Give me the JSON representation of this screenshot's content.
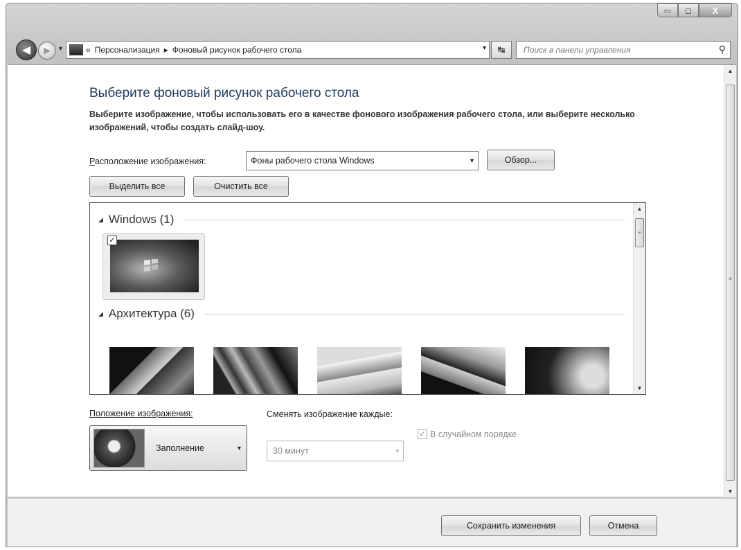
{
  "titlebar": {
    "minimize": "▭",
    "maximize": "◻",
    "close": "X"
  },
  "nav": {
    "back": "◀",
    "forward": "▶",
    "history": "▼",
    "breadcrumb_prefix": "«",
    "breadcrumb": [
      "Персонализация",
      "Фоновый рисунок рабочего стола"
    ],
    "sep": "▸",
    "address_dropdown": "▾",
    "refresh": "↹",
    "search_placeholder": "Поиск в панели управления",
    "search_icon": "⚲"
  },
  "main": {
    "title": "Выберите фоновый рисунок рабочего стола",
    "description": "Выберите изображение, чтобы использовать его в качестве фонового изображения рабочего стола, или выберите несколько изображений, чтобы создать слайд-шоу.",
    "location_label_accel": "Р",
    "location_label_rest": "асположение изображения:",
    "location_value": "Фоны рабочего стола Windows",
    "browse_button": "Обзор...",
    "select_all_button": "Выделить все",
    "clear_all_button": "Очистить все"
  },
  "gallery": {
    "groups": [
      {
        "label": "Windows (1)"
      },
      {
        "label": "Архитектура (6)"
      }
    ],
    "checked": "✓",
    "collapse_glyph": "◢",
    "scroll_up": "▲",
    "scroll_down": "▼",
    "scroll_grip": "≡"
  },
  "bottom": {
    "position_label": "Положение изображения:",
    "position_value": "Заполнение",
    "change_label": "Сменять изображение каждые:",
    "interval_value": "30 минут",
    "shuffle_label": "В случайном порядке",
    "shuffle_checked": "✓"
  },
  "footer": {
    "save_button": "Сохранить изменения",
    "cancel_button": "Отмена"
  }
}
